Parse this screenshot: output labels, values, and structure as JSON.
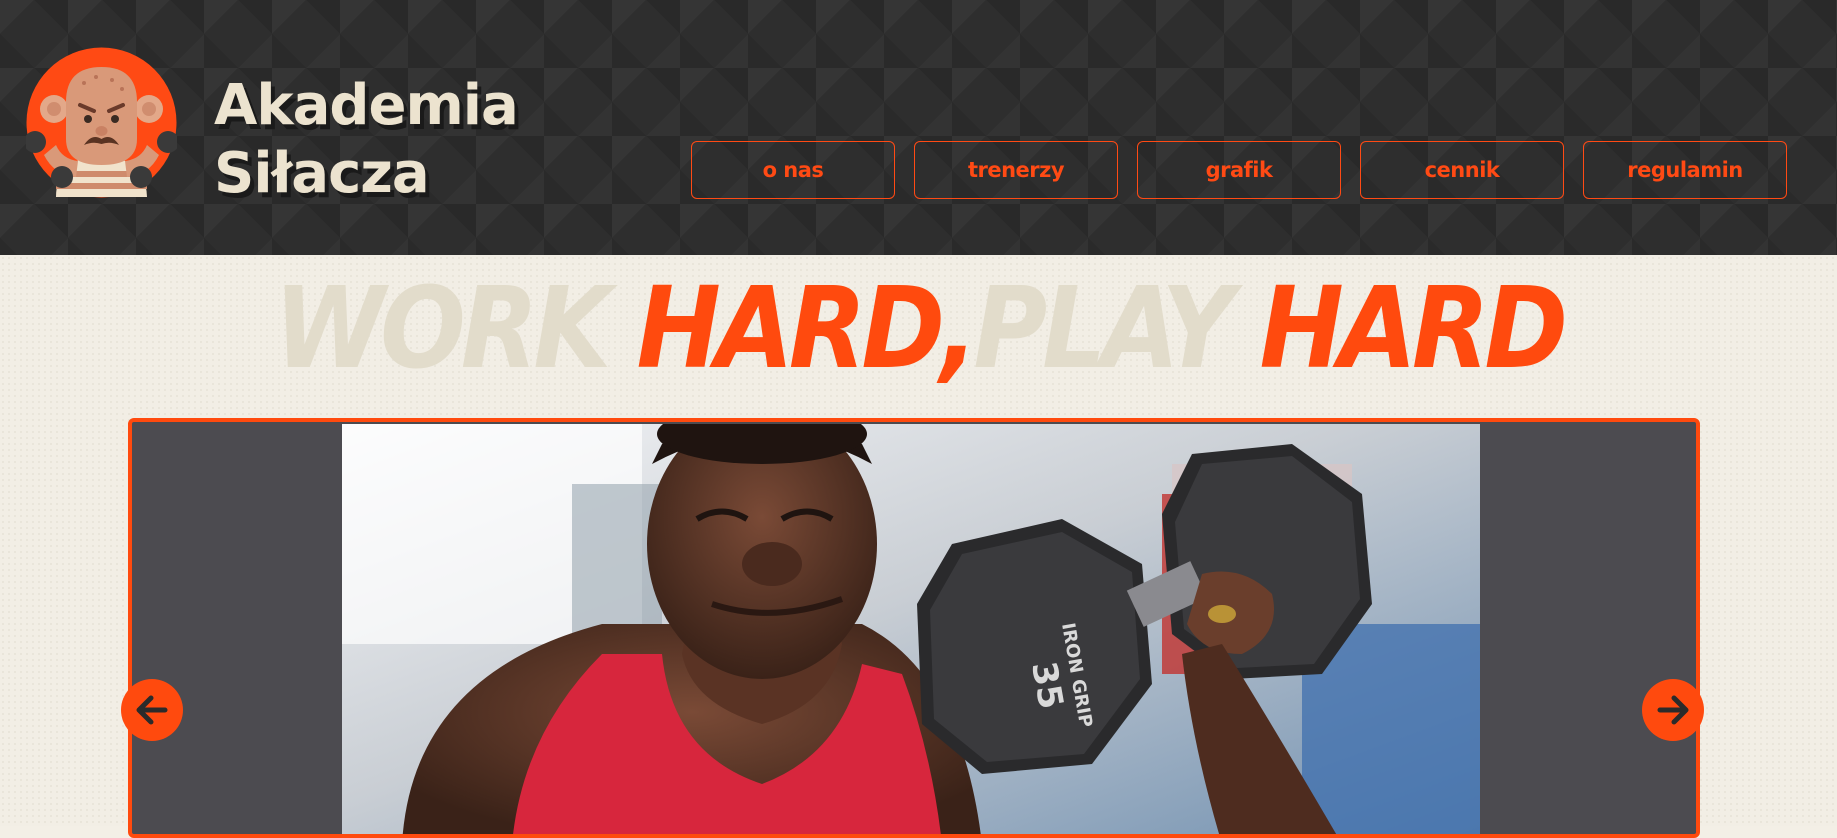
{
  "brand": {
    "line1": "Akademia",
    "line2": "Siłacza",
    "logo_icon": "strongman-mascot-icon"
  },
  "nav": {
    "items": [
      {
        "label": "o nas"
      },
      {
        "label": "trenerzy"
      },
      {
        "label": "grafik"
      },
      {
        "label": "cennik"
      },
      {
        "label": "regulamin"
      }
    ]
  },
  "hero": {
    "tagline": {
      "w1": "WORK ",
      "w2": "HARD,",
      "w3": "PLAY ",
      "w4": "HARD"
    }
  },
  "slider": {
    "prev_icon": "arrow-left-icon",
    "next_icon": "arrow-right-icon",
    "dumbbell_text": {
      "number": "35",
      "brand": "IRON GRIP"
    }
  },
  "colors": {
    "accent": "#ff4a0e",
    "header_bg": "#2e2e2e",
    "page_bg": "#f2eee5",
    "brand_text": "#ece3cf",
    "slider_bg": "#4c4b50"
  }
}
